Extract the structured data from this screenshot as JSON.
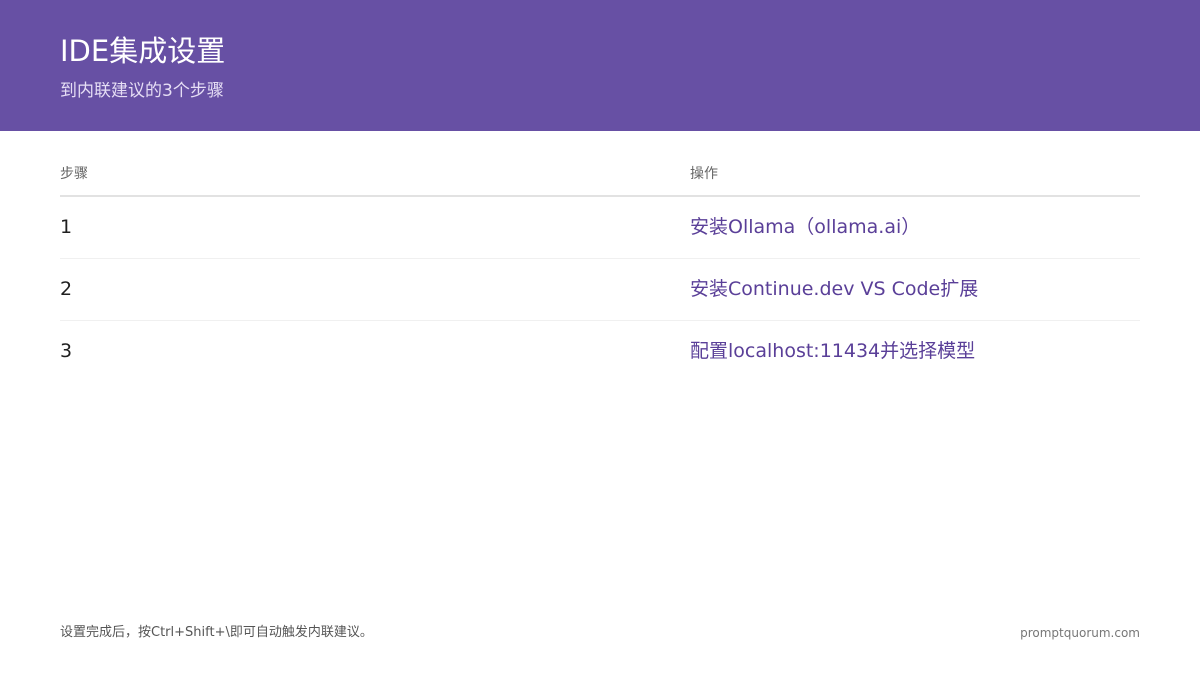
{
  "header": {
    "title": "IDE集成设置",
    "subtitle": "到内联建议的3个步骤"
  },
  "table": {
    "columns": [
      "步骤",
      "操作"
    ],
    "rows": [
      [
        "1",
        "安装Ollama（ollama.ai）"
      ],
      [
        "2",
        "安装Continue.dev VS Code扩展"
      ],
      [
        "3",
        "配置localhost:11434并选择模型"
      ]
    ]
  },
  "footer": {
    "note": "设置完成后，按Ctrl+Shift+\\即可自动触发内联建议。",
    "site": "promptquorum.com"
  },
  "colors": {
    "header_background": "#6750a4",
    "action_text": "#5a3f98"
  }
}
